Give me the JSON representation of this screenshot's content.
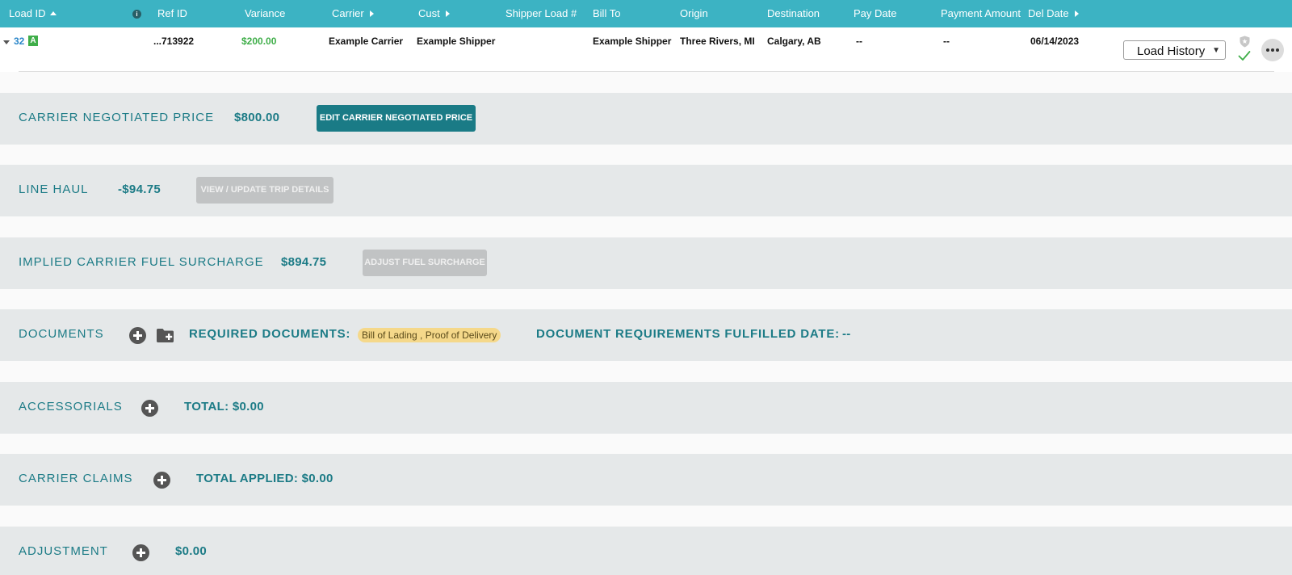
{
  "header": {
    "columns": [
      {
        "key": "load_id",
        "label": "Load ID"
      },
      {
        "key": "ref_id",
        "label": "Ref ID"
      },
      {
        "key": "variance",
        "label": "Variance"
      },
      {
        "key": "carrier",
        "label": "Carrier"
      },
      {
        "key": "cust",
        "label": "Cust"
      },
      {
        "key": "shipper_load",
        "label": "Shipper Load #"
      },
      {
        "key": "bill_to",
        "label": "Bill To"
      },
      {
        "key": "origin",
        "label": "Origin"
      },
      {
        "key": "destination",
        "label": "Destination"
      },
      {
        "key": "pay_date",
        "label": "Pay Date"
      },
      {
        "key": "payment_amount",
        "label": "Payment Amount"
      },
      {
        "key": "del_date",
        "label": "Del Date"
      }
    ],
    "info_glyph": "i"
  },
  "row": {
    "load_id": "32",
    "badge": "A",
    "ref_id": "...713922",
    "variance": "$200.00",
    "carrier": "Example Carrier",
    "cust": "Example Shipper",
    "bill_to": "Example Shipper",
    "origin": "Three Rivers, MI",
    "destination": "Calgary, AB",
    "pay_date": "--",
    "payment_amount": "--",
    "del_date": "06/14/2023",
    "actions_select": "Load History"
  },
  "sections": {
    "carrier_negotiated": {
      "label": "CARRIER NEGOTIATED PRICE",
      "value": "$800.00",
      "button": "EDIT CARRIER NEGOTIATED PRICE"
    },
    "line_haul": {
      "label": "LINE HAUL",
      "value": "-$94.75",
      "button": "VIEW / UPDATE TRIP DETAILS"
    },
    "fuel_surcharge": {
      "label": "IMPLIED CARRIER FUEL SURCHARGE",
      "value": "$894.75",
      "button": "ADJUST FUEL SURCHARGE"
    },
    "documents": {
      "label": "DOCUMENTS",
      "required_label": "REQUIRED DOCUMENTS:",
      "required_value": "Bill of Lading , Proof of Delivery",
      "fulfilled_label": "DOCUMENT REQUIREMENTS FULFILLED DATE:",
      "fulfilled_value": "--"
    },
    "accessorials": {
      "label": "ACCESSORIALS",
      "total": "TOTAL: $0.00"
    },
    "carrier_claims": {
      "label": "CARRIER CLAIMS",
      "total": "TOTAL APPLIED: $0.00"
    },
    "adjustment": {
      "label": "ADJUSTMENT",
      "value": "$0.00"
    }
  },
  "colors": {
    "header_bg": "#3cb3c3",
    "accent_teal": "#1c7b86",
    "primary_button": "#1a7b86",
    "band_bg": "#e5e8e9",
    "variance_green": "#3fae49",
    "link_blue": "#2a86c9",
    "required_badge": "#f5d88a"
  },
  "icons": [
    "sort-up-icon",
    "info-icon",
    "sort-right-icon",
    "expand-caret-icon",
    "shield-icon",
    "check-icon",
    "more-icon",
    "add-icon",
    "add-folder-icon"
  ]
}
